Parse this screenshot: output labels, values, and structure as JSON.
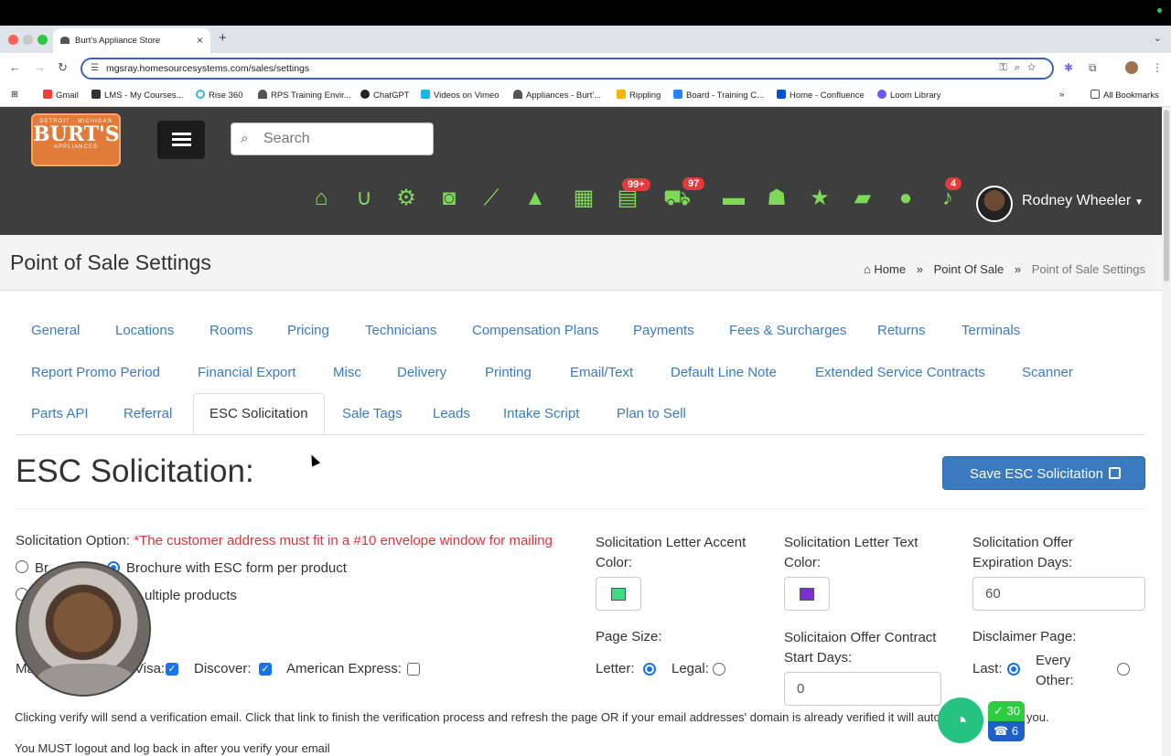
{
  "browser": {
    "tab_title": "Burt's Appliance Store",
    "url": "mgsray.homesourcesystems.com/sales/settings",
    "bookmarks": [
      "Gmail",
      "LMS - My Courses...",
      "Rise 360",
      "RPS Training Envir...",
      "ChatGPT",
      "Videos on Vimeo",
      "Appliances - Burt'...",
      "Rippling",
      "Board - Training C...",
      "Home - Confluence",
      "Loom Library"
    ],
    "all_bookmarks": "All Bookmarks",
    "more": "»"
  },
  "header": {
    "logo_top": "DETROIT · MICHIGAN",
    "logo_main": "BURT'S",
    "logo_sub": "APPLIANCES",
    "search_placeholder": "Search",
    "badges": {
      "notes": "99+",
      "cart": "97",
      "bell": "4"
    },
    "user_name": "Rodney Wheeler"
  },
  "page": {
    "title": "Point of Sale Settings",
    "breadcrumb": [
      "Home",
      "Point Of Sale",
      "Point of Sale Settings"
    ]
  },
  "tabs": {
    "row1": [
      "General",
      "Locations",
      "Rooms",
      "Pricing",
      "Technicians",
      "Compensation Plans",
      "Payments",
      "Fees & Surcharges",
      "Returns",
      "Terminals"
    ],
    "row2": [
      "Report Promo Period",
      "Financial Export",
      "Misc",
      "Delivery",
      "Printing",
      "Email/Text",
      "Default Line Note",
      "Extended Service Contracts",
      "Scanner"
    ],
    "row3": [
      "Parts API",
      "Referral",
      "ESC Solicitation",
      "Sale Tags",
      "Leads",
      "Intake Script",
      "Plan to Sell"
    ]
  },
  "section": {
    "title": "ESC Solicitation:",
    "save_label": "Save ESC Solicitation"
  },
  "form": {
    "solicitation_option_label": "Solicitation Option:",
    "solicitation_warning": "*The customer address must fit in a #10 envelope window for mailing",
    "option1_partial": "Br",
    "option2": "Brochure with ESC form per product",
    "option3_partial": "ultiple products",
    "accent_color_label": "Solicitation Letter Accent Color:",
    "accent_color": "#3ddc84",
    "text_color_label": "Solicitation Letter Text Color:",
    "text_color": "#7b2fd6",
    "expiration_label": "Solicitation Offer Expiration Days:",
    "expiration_value": "60",
    "page_size_label": "Page Size:",
    "letter": "Letter:",
    "legal": "Legal:",
    "contract_start_label": "Solicitaion Offer Contract Start Days:",
    "contract_start_value": "0",
    "disclaimer_label": "Disclaimer Page:",
    "last": "Last:",
    "every_other": "Every Other:",
    "card_ma": "Ma",
    "visa": "Visa:",
    "discover": "Discover:",
    "amex": "American Express:",
    "note1": "Clicking verify will send a verification email. Click that link to finish the verification process and refresh the page OR if your email addresses' domain is already verified it will auto",
    "note1_tail": "you.",
    "note2": "You MUST logout and log back in after you verify your email"
  },
  "widgets": {
    "green_count": "30",
    "blue_count": "6"
  }
}
